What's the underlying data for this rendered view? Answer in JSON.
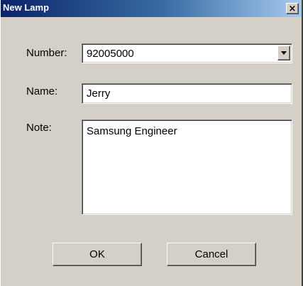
{
  "window": {
    "title": "New Lamp",
    "close_glyph": "×",
    "close_icon": "close-icon"
  },
  "form": {
    "number_label": "Number:",
    "number_value": "92005000",
    "dropdown_icon": "chevron-down-icon",
    "name_label": "Name:",
    "name_value": "Jerry",
    "note_label": "Note:",
    "note_value": "Samsung Engineer"
  },
  "buttons": {
    "ok_label": "OK",
    "cancel_label": "Cancel"
  },
  "colors": {
    "dialog_bg": "#d4d0c8",
    "title_bar": "#0a246a",
    "field_bg": "#ffffff"
  }
}
